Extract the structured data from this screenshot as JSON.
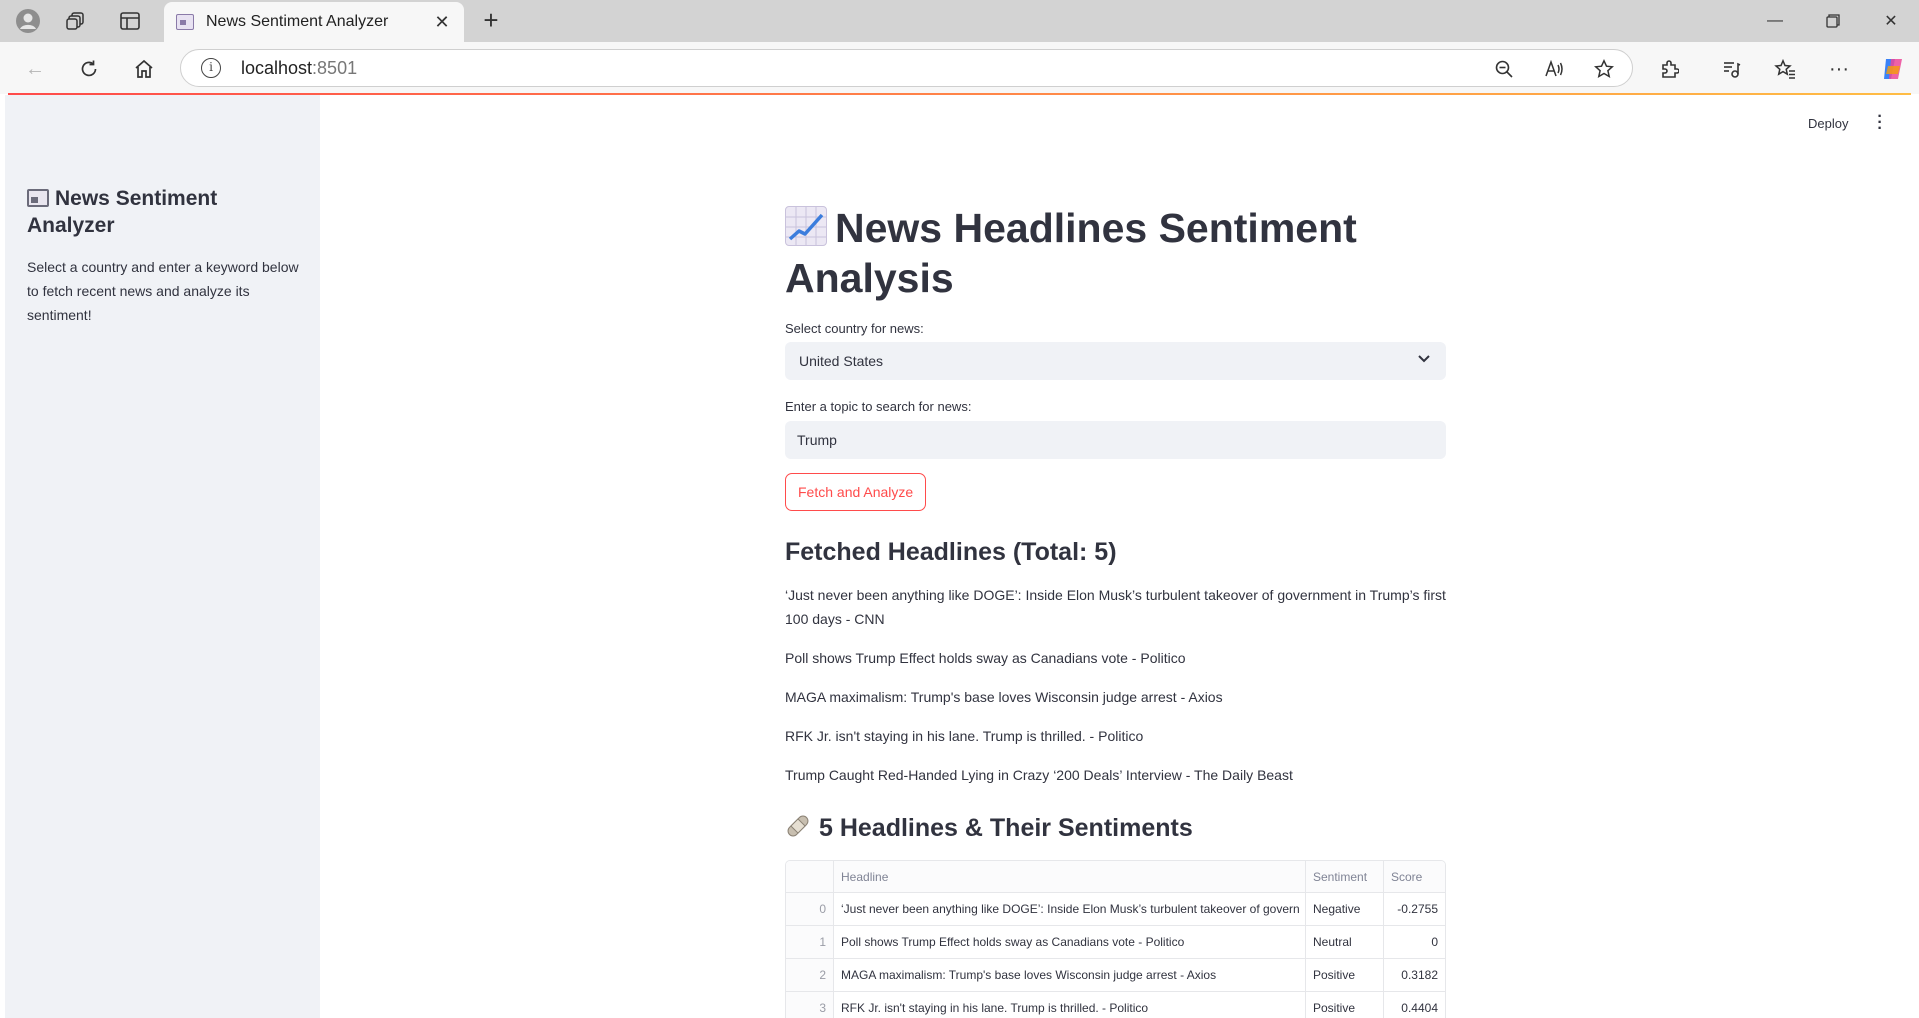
{
  "browser": {
    "tab_title": "News Sentiment Analyzer",
    "url_host": "localhost",
    "url_port": ":8501"
  },
  "app": {
    "deploy_label": "Deploy"
  },
  "sidebar": {
    "title": "News Sentiment Analyzer",
    "description": "Select a country and enter a keyword below to fetch recent news and analyze its sentiment!"
  },
  "main": {
    "title": "News Headlines Sentiment Analysis",
    "country_label": "Select country for news:",
    "country_value": "United States",
    "topic_label": "Enter a topic to search for news:",
    "topic_value": "Trump",
    "fetch_button": "Fetch and Analyze",
    "fetched_heading": "Fetched Headlines (Total: 5)",
    "headlines": [
      "‘Just never been anything like DOGE’: Inside Elon Musk’s turbulent takeover of government in Trump’s first 100 days - CNN",
      "Poll shows Trump Effect holds sway as Canadians vote - Politico",
      "MAGA maximalism: Trump's base loves Wisconsin judge arrest - Axios",
      "RFK Jr. isn't staying in his lane. Trump is thrilled. - Politico",
      "Trump Caught Red-Handed Lying in Crazy ‘200 Deals’ Interview - The Daily Beast"
    ],
    "sentiments_heading": "5 Headlines & Their Sentiments",
    "table": {
      "columns": [
        "",
        "Headline",
        "Sentiment",
        "Score"
      ],
      "rows": [
        {
          "index": "0",
          "headline": "‘Just never been anything like DOGE’: Inside Elon Musk’s turbulent takeover of govern",
          "sentiment": "Negative",
          "score": "-0.2755"
        },
        {
          "index": "1",
          "headline": "Poll shows Trump Effect holds sway as Canadians vote - Politico",
          "sentiment": "Neutral",
          "score": "0"
        },
        {
          "index": "2",
          "headline": "MAGA maximalism: Trump's base loves Wisconsin judge arrest - Axios",
          "sentiment": "Positive",
          "score": "0.3182"
        },
        {
          "index": "3",
          "headline": "RFK Jr. isn't staying in his lane. Trump is thrilled. - Politico",
          "sentiment": "Positive",
          "score": "0.4404"
        }
      ]
    }
  }
}
